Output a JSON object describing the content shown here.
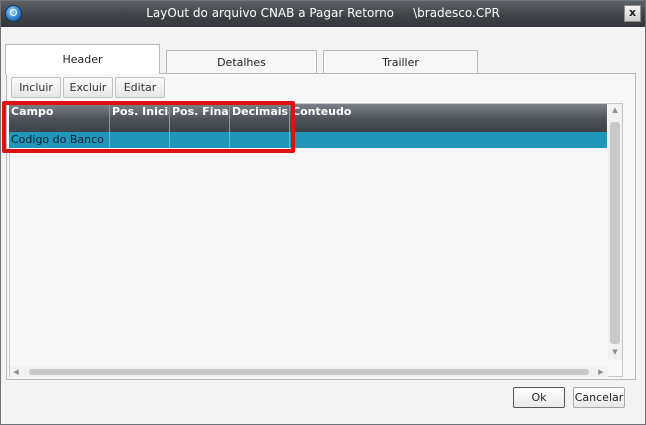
{
  "window": {
    "title": "LayOut do arquivo CNAB a Pagar Retorno     \\bradesco.CPR",
    "close_label": "x"
  },
  "tabs": [
    {
      "label": "Header",
      "active": true
    },
    {
      "label": "Detalhes",
      "active": false
    },
    {
      "label": "Trailler",
      "active": false
    }
  ],
  "toolbar": {
    "incluir_label": "Incluir",
    "excluir_label": "Excluir",
    "editar_label": "Editar"
  },
  "grid": {
    "columns": [
      "Campo",
      "Pos. Inicial",
      "Pos. Final",
      "Decimais",
      "Conteudo"
    ],
    "rows": [
      {
        "campo": "Codigo do Banco",
        "pos_inicial": "",
        "pos_final": "",
        "decimais": "",
        "conteudo": ""
      }
    ],
    "selected_row_color": "#2196b8",
    "header_color": "#4b5156"
  },
  "highlight": {
    "color": "#e01010"
  },
  "footer": {
    "ok_label": "Ok",
    "cancel_label": "Cancelar"
  }
}
